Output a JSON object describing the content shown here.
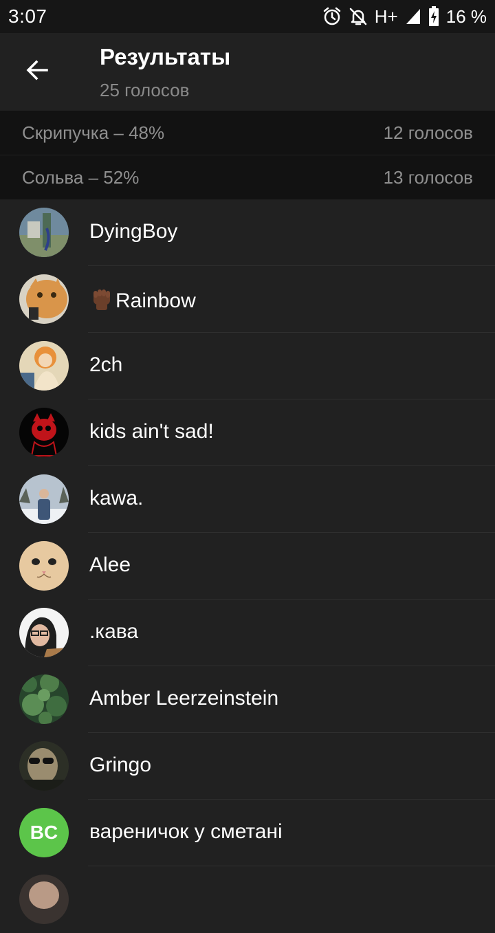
{
  "status": {
    "time": "3:07",
    "network": "H+",
    "battery": "16 %",
    "icons": [
      "alarm-icon",
      "bell-off-icon",
      "signal-icon",
      "battery-charging-icon"
    ]
  },
  "header": {
    "title": "Результаты",
    "subtitle": "25 голосов",
    "back_icon": "back-arrow-icon"
  },
  "options": [
    {
      "label": "Скрипучка – 48%",
      "votes": "12 голосов",
      "percent": 48
    },
    {
      "label": "Сольва – 52%",
      "votes": "13 голосов",
      "percent": 52
    }
  ],
  "voters": [
    {
      "name": "DyingBoy",
      "avatar": "photo"
    },
    {
      "name": "Rainbow",
      "prefix_emoji": "raised-fist",
      "avatar": "photo-cat"
    },
    {
      "name": "2ch",
      "avatar": "photo-anime"
    },
    {
      "name": "kids ain't sad!",
      "avatar": "photo-red-cat"
    },
    {
      "name": "kawa.",
      "avatar": "photo-person-snow"
    },
    {
      "name": "Alee",
      "avatar": "photo-cat-face"
    },
    {
      "name": ".кава",
      "avatar": "photo-person"
    },
    {
      "name": "Amber Leerzeinstein",
      "avatar": "photo-trees"
    },
    {
      "name": "Gringo",
      "avatar": "photo-person-sunglasses"
    },
    {
      "name": "вареничок у сметані",
      "avatar_initials": "BC",
      "avatar_color": "#5cc54a"
    }
  ],
  "colors": {
    "background": "#212121",
    "option_background": "#121212",
    "secondary_text": "#8f8f8f",
    "initials_green": "#5cc54a"
  }
}
